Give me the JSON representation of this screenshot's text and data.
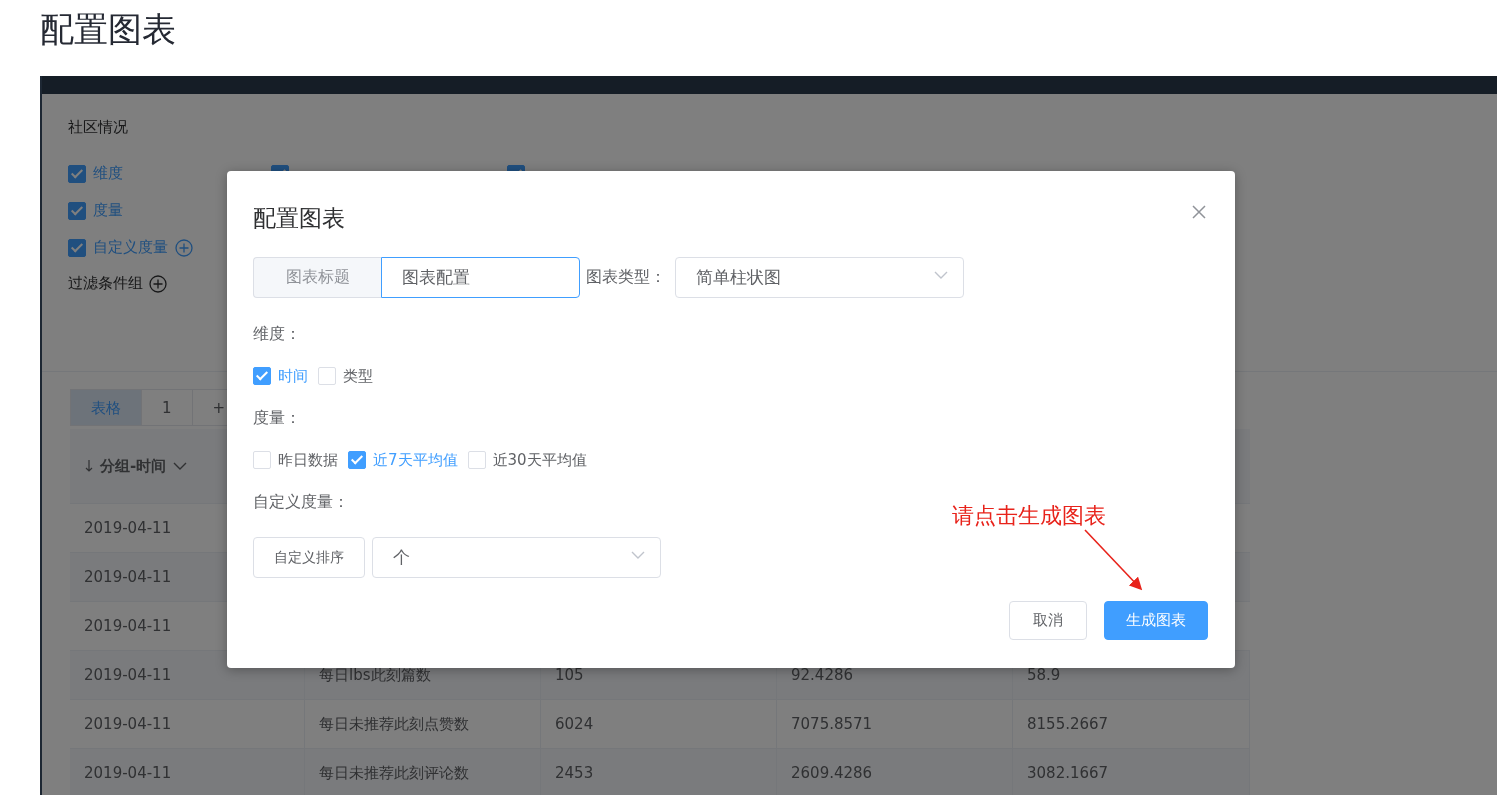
{
  "page_title": "配置图表",
  "app": {
    "section_title": "社区情况",
    "options": [
      {
        "label": "维度",
        "checked": true,
        "addable": false
      },
      {
        "label": "度量",
        "checked": true,
        "addable": false
      },
      {
        "label": "自定义度量",
        "checked": true,
        "addable": true
      }
    ],
    "dimension_values": [
      {
        "checked": true
      },
      {
        "checked": true
      }
    ],
    "filter_group": {
      "label": "过滤条件组"
    },
    "tabs": [
      {
        "label": "表格",
        "selected": true
      },
      {
        "label": "1",
        "selected": false
      },
      {
        "label": "+",
        "selected": false
      }
    ],
    "table": {
      "columns": [
        {
          "label": "分组-时间"
        }
      ],
      "rows": [
        {
          "cells": [
            "2019-04-11"
          ]
        },
        {
          "cells": [
            "2019-04-11"
          ]
        },
        {
          "cells": [
            "2019-04-11"
          ]
        },
        {
          "cells": [
            "2019-04-11",
            "每日lbs此刻篇数",
            "105",
            "92.4286",
            "58.9"
          ]
        },
        {
          "cells": [
            "2019-04-11",
            "每日未推荐此刻点赞数",
            "6024",
            "7075.8571",
            "8155.2667"
          ]
        },
        {
          "cells": [
            "2019-04-11",
            "每日未推荐此刻评论数",
            "2453",
            "2609.4286",
            "3082.1667"
          ]
        }
      ]
    }
  },
  "dialog": {
    "title": "配置图表",
    "title_field": {
      "label": "图表标题",
      "value": "图表配置"
    },
    "chart_type": {
      "label": "图表类型：",
      "value": "简单柱状图"
    },
    "dimensions": {
      "label": "维度：",
      "options": [
        {
          "label": "时间",
          "checked": true
        },
        {
          "label": "类型",
          "checked": false
        }
      ]
    },
    "measures": {
      "label": "度量：",
      "options": [
        {
          "label": "昨日数据",
          "checked": false
        },
        {
          "label": "近7天平均值",
          "checked": true
        },
        {
          "label": "近30天平均值",
          "checked": false
        }
      ]
    },
    "custom_measure": {
      "label": "自定义度量：",
      "button": "自定义排序",
      "value": "个"
    },
    "buttons": [
      {
        "label": "取消",
        "kind": "secondary"
      },
      {
        "label": "生成图表",
        "kind": "primary"
      }
    ]
  },
  "annotation": {
    "text": "请点击生成图表"
  }
}
